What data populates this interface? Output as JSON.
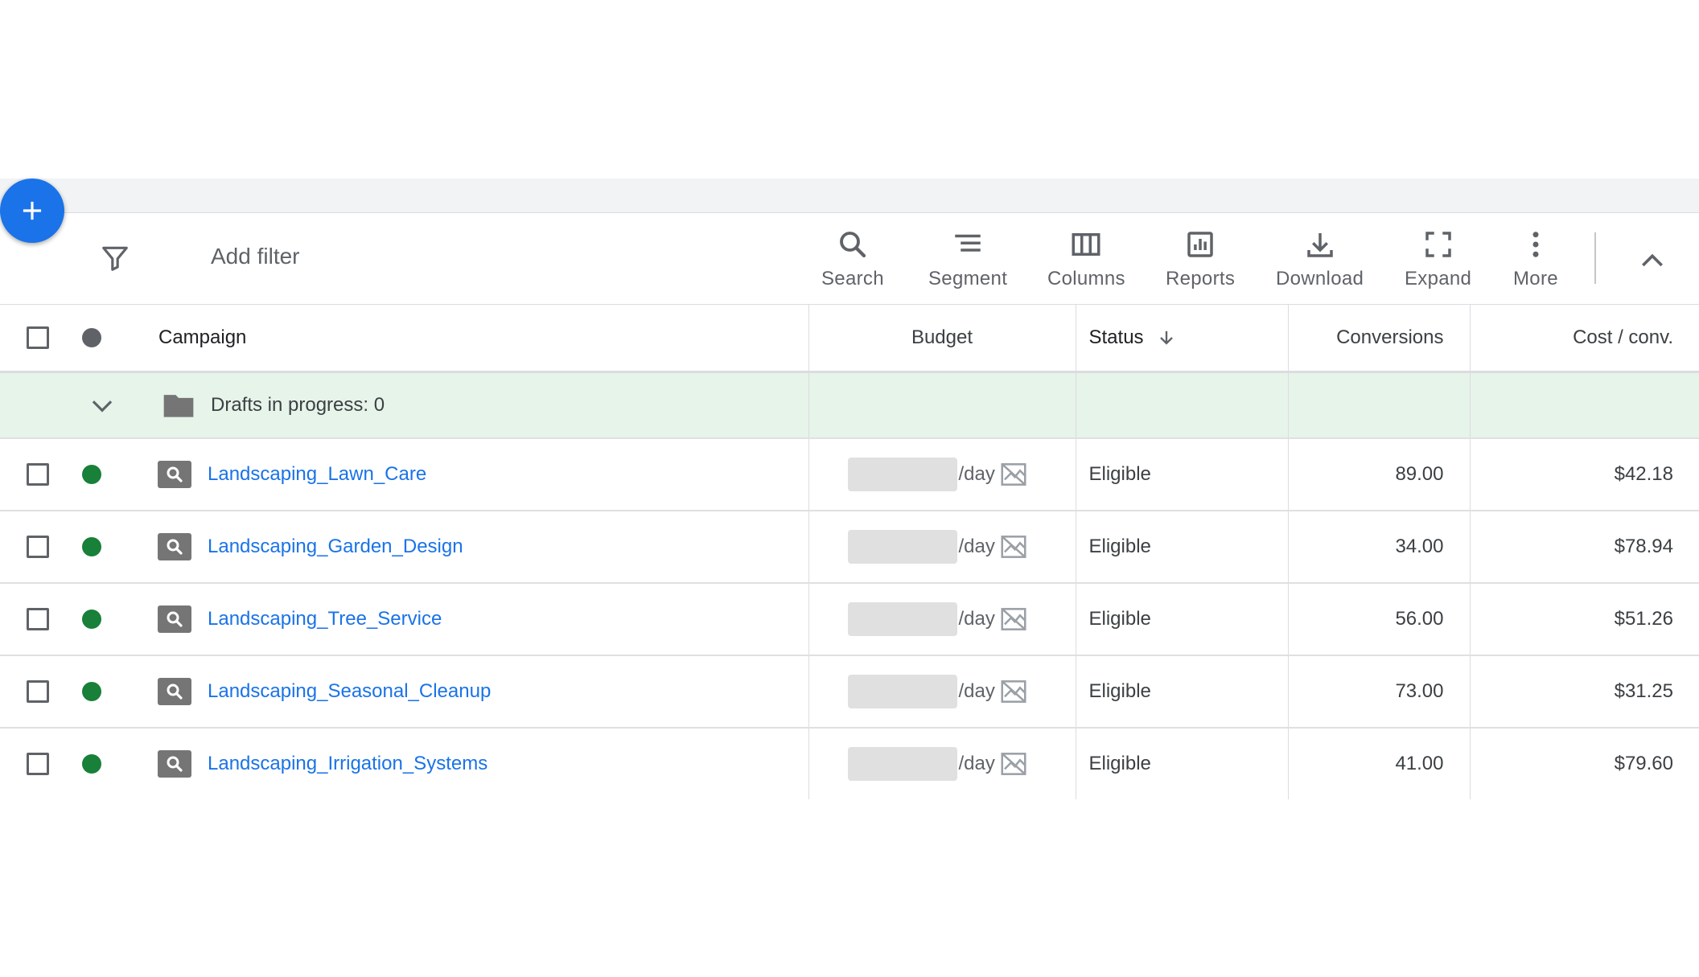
{
  "toolbar": {
    "add_filter": "Add filter",
    "tools": [
      {
        "label": "Search",
        "icon": "search-icon"
      },
      {
        "label": "Segment",
        "icon": "segment-icon"
      },
      {
        "label": "Columns",
        "icon": "columns-icon"
      },
      {
        "label": "Reports",
        "icon": "reports-icon"
      },
      {
        "label": "Download",
        "icon": "download-icon"
      },
      {
        "label": "Expand",
        "icon": "expand-icon"
      },
      {
        "label": "More",
        "icon": "more-vert-icon"
      }
    ]
  },
  "table": {
    "headers": {
      "campaign": "Campaign",
      "budget": "Budget",
      "status": "Status",
      "conversions": "Conversions",
      "cost_conv": "Cost / conv."
    },
    "drafts": {
      "label": "Drafts in progress: 0"
    },
    "rows": [
      {
        "name": "Landscaping_Lawn_Care",
        "budget_suffix": "/day",
        "status": "Eligible",
        "conversions": "89.00",
        "cost": "$42.18"
      },
      {
        "name": "Landscaping_Garden_Design",
        "budget_suffix": "/day",
        "status": "Eligible",
        "conversions": "34.00",
        "cost": "$78.94"
      },
      {
        "name": "Landscaping_Tree_Service",
        "budget_suffix": "/day",
        "status": "Eligible",
        "conversions": "56.00",
        "cost": "$51.26"
      },
      {
        "name": "Landscaping_Seasonal_Cleanup",
        "budget_suffix": "/day",
        "status": "Eligible",
        "conversions": "73.00",
        "cost": "$31.25"
      },
      {
        "name": "Landscaping_Irrigation_Systems",
        "budget_suffix": "/day",
        "status": "Eligible",
        "conversions": "41.00",
        "cost": "$79.60"
      }
    ]
  },
  "colors": {
    "accent": "#1a73e8",
    "status_enabled": "#188038",
    "header_dot": "#5f6368",
    "drafts_bg": "#e6f4ea"
  }
}
